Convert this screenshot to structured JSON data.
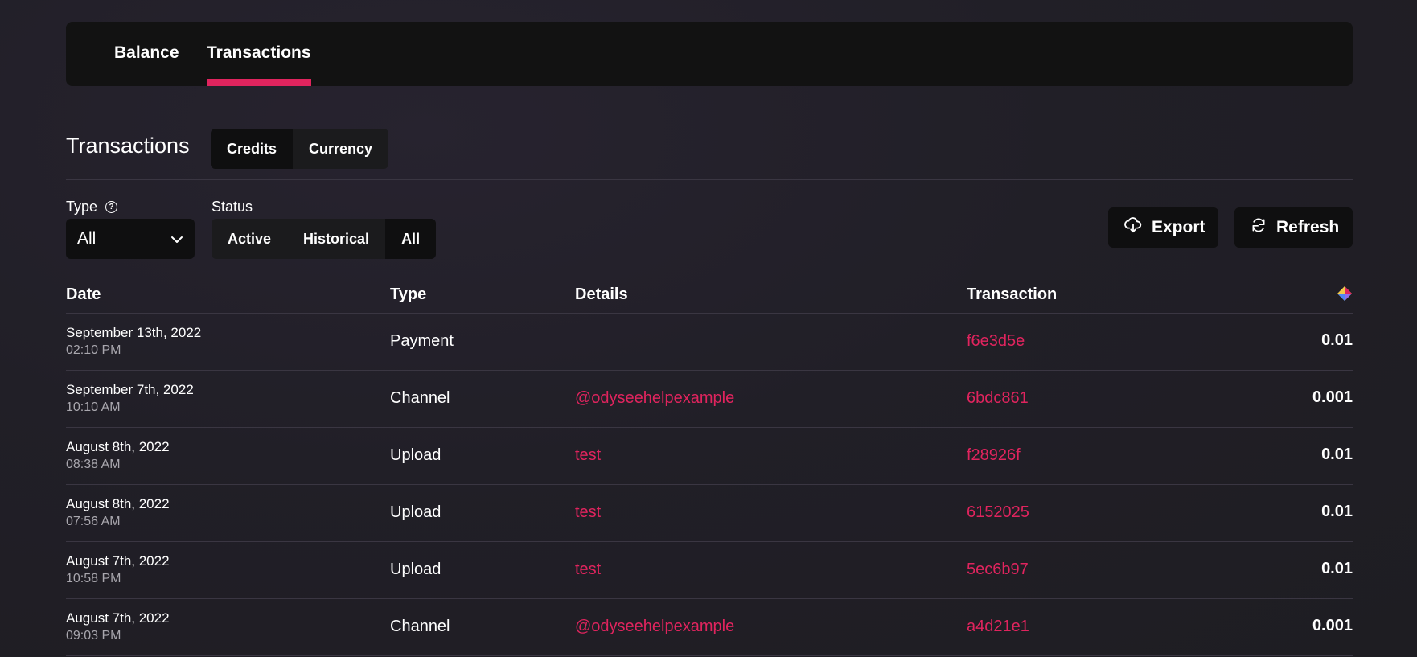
{
  "tabs": [
    {
      "label": "Balance"
    },
    {
      "label": "Transactions"
    }
  ],
  "colors": {
    "accent": "#e0245e",
    "background": "#211f27",
    "panel": "#121212"
  },
  "section": {
    "title": "Transactions",
    "toggle": [
      "Credits",
      "Currency"
    ],
    "toggle_selected": "Credits"
  },
  "filters": {
    "type_label": "Type",
    "type_value": "All",
    "status_label": "Status",
    "status_options": [
      "Active",
      "Historical",
      "All"
    ],
    "status_selected": "All"
  },
  "actions": {
    "export_label": "Export",
    "refresh_label": "Refresh"
  },
  "table": {
    "headers": {
      "date": "Date",
      "type": "Type",
      "details": "Details",
      "transaction": "Transaction",
      "amount_icon": "credits-icon"
    },
    "rows": [
      {
        "date": "September 13th, 2022",
        "time": "02:10 PM",
        "type": "Payment",
        "details": "",
        "tx": "f6e3d5e",
        "amount": "0.01"
      },
      {
        "date": "September 7th, 2022",
        "time": "10:10 AM",
        "type": "Channel",
        "details": "@odyseehelpexample",
        "tx": "6bdc861",
        "amount": "0.001"
      },
      {
        "date": "August 8th, 2022",
        "time": "08:38 AM",
        "type": "Upload",
        "details": "test",
        "tx": "f28926f",
        "amount": "0.01"
      },
      {
        "date": "August 8th, 2022",
        "time": "07:56 AM",
        "type": "Upload",
        "details": "test",
        "tx": "6152025",
        "amount": "0.01"
      },
      {
        "date": "August 7th, 2022",
        "time": "10:58 PM",
        "type": "Upload",
        "details": "test",
        "tx": "5ec6b97",
        "amount": "0.01"
      },
      {
        "date": "August 7th, 2022",
        "time": "09:03 PM",
        "type": "Channel",
        "details": "@odyseehelpexample",
        "tx": "a4d21e1",
        "amount": "0.001"
      }
    ]
  }
}
